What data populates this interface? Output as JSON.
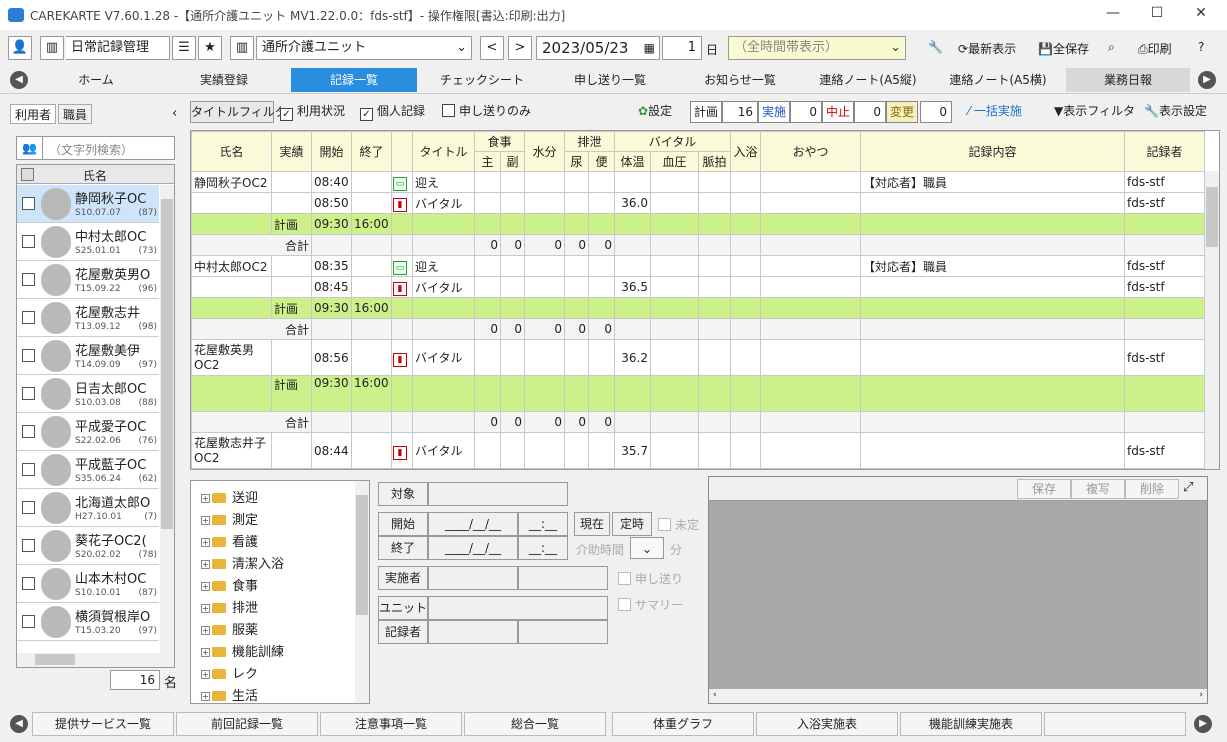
{
  "window": {
    "title": "CAREKARTE V7.60.1.28 -【通所介護ユニット MV1.22.0.0：fds-stf】- 操作権限[書込:印刷:出力]"
  },
  "toolbar": {
    "menu_label": "日常記録管理",
    "unit_select": "通所介護ユニット",
    "date": "2023/05/23",
    "days": "1",
    "days_unit": "日",
    "time_select": "（全時間帯表示）",
    "refresh": "最新表示",
    "save_all": "全保存",
    "print": "印刷"
  },
  "nav": {
    "tabs": [
      "ホーム",
      "実績登録",
      "記録一覧",
      "チェックシート",
      "申し送り一覧",
      "お知らせ一覧",
      "連絡ノート(A5縦)",
      "連絡ノート(A5横)",
      "業務日報"
    ]
  },
  "left": {
    "tabs": [
      "利用者",
      "職員"
    ],
    "search_placeholder": "（文字列検索）",
    "name_header": "氏名",
    "users": [
      {
        "name": "静岡秋子OC",
        "date": "S10.07.07",
        "age": "(87)"
      },
      {
        "name": "中村太郎OC",
        "date": "S25.01.01",
        "age": "(73)"
      },
      {
        "name": "花屋敷英男O",
        "date": "T15.09.22",
        "age": "(96)"
      },
      {
        "name": "花屋敷志井",
        "date": "T13.09.12",
        "age": "(98)"
      },
      {
        "name": "花屋敷美伊",
        "date": "T14.09.09",
        "age": "(97)"
      },
      {
        "name": "日吉太郎OC",
        "date": "S10.03.08",
        "age": "(88)"
      },
      {
        "name": "平成愛子OC",
        "date": "S22.02.06",
        "age": "(76)"
      },
      {
        "name": "平成藍子OC",
        "date": "S35.06.24",
        "age": "(62)"
      },
      {
        "name": "北海道太郎O",
        "date": "H27.10.01",
        "age": "(7)"
      },
      {
        "name": "葵花子OC2(",
        "date": "S20.02.02",
        "age": "(78)"
      },
      {
        "name": "山本木村OC",
        "date": "S10.10.01",
        "age": "(87)"
      },
      {
        "name": "横須賀根岸O",
        "date": "T15.03.20",
        "age": "(97)"
      }
    ],
    "count": "16",
    "count_unit": "名"
  },
  "filter": {
    "title_filter": "タイトルフィルタ",
    "usage": "利用状況",
    "personal": "個人記録",
    "handover_only": "申し送りのみ",
    "settings": "設定",
    "plan_label": "計画",
    "plan_count": "16",
    "done_label": "実施",
    "done_count": "0",
    "cancel_label": "中止",
    "cancel_count": "0",
    "change_label": "変更",
    "change_count": "0",
    "bulk": "一括実施",
    "display_filter": "表示フィルタ",
    "display_settings": "表示設定"
  },
  "grid": {
    "headers": {
      "name": "氏名",
      "result": "実績",
      "start": "開始",
      "end": "終了",
      "title": "タイトル",
      "meal": "食事",
      "meal_main": "主",
      "meal_side": "副",
      "water": "水分",
      "excretion": "排泄",
      "urine": "尿",
      "stool": "便",
      "vital": "バイタル",
      "temp": "体温",
      "bp": "血圧",
      "pulse": "脈拍",
      "bath": "入浴",
      "snack": "おやつ",
      "content": "記録内容",
      "recorder": "記録者"
    },
    "rows": [
      {
        "type": "rec",
        "name": "静岡秋子OC2",
        "start": "08:40",
        "icon": "bus",
        "title": "迎え",
        "temp": "",
        "content": "【対応者】職員",
        "recorder": "fds-stf"
      },
      {
        "type": "rec",
        "name": "",
        "start": "08:50",
        "icon": "vit",
        "title": "バイタル",
        "temp": "36.0",
        "content": "",
        "recorder": "fds-stf"
      },
      {
        "type": "plan",
        "result": "計画",
        "start": "09:30",
        "end": "16:00"
      },
      {
        "type": "sum",
        "label": "合計",
        "v": [
          "0",
          "0",
          "0",
          "0",
          "0"
        ]
      },
      {
        "type": "rec",
        "name": "中村太郎OC2",
        "start": "08:35",
        "icon": "bus",
        "title": "迎え",
        "temp": "",
        "content": "【対応者】職員",
        "recorder": "fds-stf"
      },
      {
        "type": "rec",
        "name": "",
        "start": "08:45",
        "icon": "vit",
        "title": "バイタル",
        "temp": "36.5",
        "content": "",
        "recorder": "fds-stf"
      },
      {
        "type": "plan",
        "result": "計画",
        "start": "09:30",
        "end": "16:00"
      },
      {
        "type": "sum",
        "label": "合計",
        "v": [
          "0",
          "0",
          "0",
          "0",
          "0"
        ]
      },
      {
        "type": "rec2",
        "name": "花屋敷英男",
        "name2": "OC2",
        "start": "08:56",
        "icon": "vit",
        "title": "バイタル",
        "temp": "36.2",
        "content": "",
        "recorder": "fds-stf"
      },
      {
        "type": "plan2",
        "result": "計画",
        "start": "09:30",
        "end": "16:00"
      },
      {
        "type": "sum",
        "label": "合計",
        "v": [
          "0",
          "0",
          "0",
          "0",
          "0"
        ]
      },
      {
        "type": "rec2",
        "name": "花屋敷志井子",
        "name2": "OC2",
        "start": "08:44",
        "icon": "vit",
        "title": "バイタル",
        "temp": "35.7",
        "content": "",
        "recorder": "fds-stf"
      }
    ]
  },
  "tree": {
    "items": [
      "送迎",
      "測定",
      "看護",
      "清潔入浴",
      "食事",
      "排泄",
      "服薬",
      "機能訓練",
      "レク",
      "生活"
    ]
  },
  "form": {
    "target": "対象",
    "start": "開始",
    "end": "終了",
    "date_ph": "____/__/__",
    "time_ph": "__:__",
    "now": "現在",
    "fixed": "定時",
    "undecided": "未定",
    "assist_time": "介助時間",
    "minutes": "分",
    "executor": "実施者",
    "handover": "申し送り",
    "unit": "ユニット",
    "summary": "サマリー",
    "recorder": "記録者"
  },
  "detail": {
    "save": "保存",
    "copy": "複写",
    "delete": "削除"
  },
  "bottom": {
    "buttons": [
      "提供サービス一覧",
      "前回記録一覧",
      "注意事項一覧",
      "総合一覧",
      "体重グラフ",
      "入浴実施表",
      "機能訓練実施表"
    ]
  }
}
